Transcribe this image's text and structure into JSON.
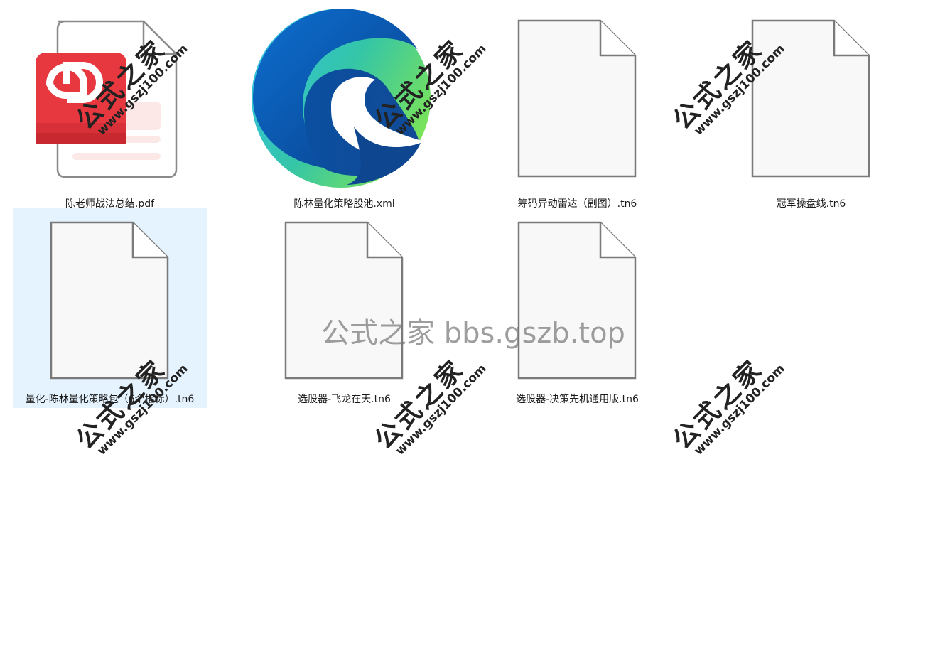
{
  "files": [
    {
      "name": "陈老师战法总结.pdf",
      "icon": "pdf-file-icon",
      "selected": false
    },
    {
      "name": "陈林量化策略股池.xml",
      "icon": "edge-browser-icon",
      "selected": false
    },
    {
      "name": "筹码异动雷达（副图）.tn6",
      "icon": "blank-file-icon",
      "selected": false
    },
    {
      "name": "冠军操盘线.tn6",
      "icon": "blank-file-icon",
      "selected": false
    },
    {
      "name": "量化-陈林量化策略包（6个指标）.tn6",
      "icon": "blank-file-icon",
      "selected": true
    },
    {
      "name": "选股器-飞龙在天.tn6",
      "icon": "blank-file-icon",
      "selected": false
    },
    {
      "name": "选股器-决策先机通用版.tn6",
      "icon": "blank-file-icon",
      "selected": false
    }
  ],
  "watermark": {
    "center_text": "公式之家 bbs.gszb.top",
    "stamp_cn": "公式之家",
    "stamp_url": "www.gszj100.com"
  },
  "colors": {
    "selection": "#e5f3ff",
    "pdf_red": "#e8383f",
    "edge_blue": "#0c59a4",
    "edge_green": "#5fd35a"
  }
}
